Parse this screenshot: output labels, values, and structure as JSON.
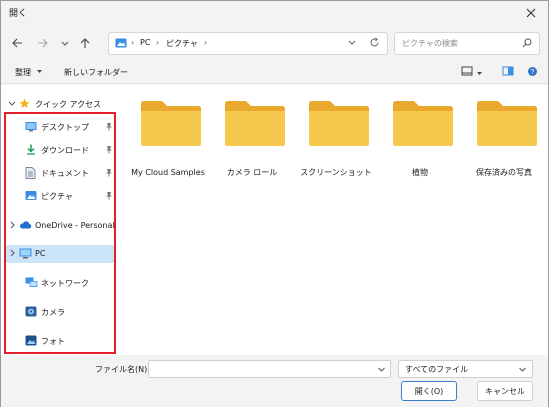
{
  "window": {
    "title": "開く"
  },
  "nav": {
    "breadcrumbs": [
      "PC",
      "ピクチャ"
    ],
    "search_placeholder": "ピクチャの検索"
  },
  "toolbar": {
    "organize": "整理",
    "new_folder": "新しいフォルダー"
  },
  "sidebar": {
    "quick_access": "クイック アクセス",
    "items": [
      {
        "label": "デスクトップ",
        "icon": "desktop-icon",
        "pinned": true
      },
      {
        "label": "ダウンロード",
        "icon": "download-icon",
        "pinned": true
      },
      {
        "label": "ドキュメント",
        "icon": "document-icon",
        "pinned": true
      },
      {
        "label": "ピクチャ",
        "icon": "pictures-icon",
        "pinned": true
      }
    ],
    "onedrive": "OneDrive - Personal",
    "pc": "PC",
    "network": "ネットワーク",
    "camera": "カメラ",
    "photos": "フォト"
  },
  "files": [
    {
      "label": "My Cloud Samples"
    },
    {
      "label": "カメラ ロール"
    },
    {
      "label": "スクリーンショット"
    },
    {
      "label": "植物"
    },
    {
      "label": "保存済みの写真"
    }
  ],
  "footer": {
    "filename_label": "ファイル名(N):",
    "filename_value": "",
    "filetype": "すべてのファイル",
    "open_button": "開く(O)",
    "cancel_button": "キャンセル"
  },
  "colors": {
    "accent": "#3c7fd1",
    "highlight": "#e0202a",
    "selected": "#cce4f7",
    "folder": "#f6c94e"
  }
}
